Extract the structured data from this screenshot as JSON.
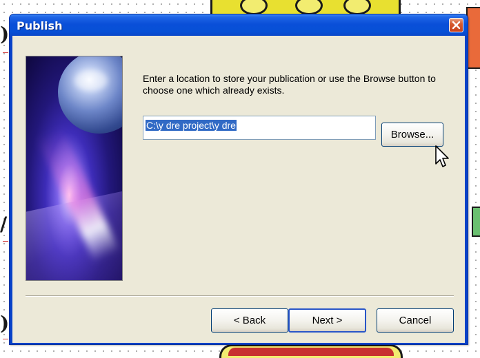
{
  "dialog": {
    "title": "Publish",
    "instructions": "Enter a location to store your publication or use the Browse button to choose one which already exists.",
    "path_value": "C:\\y dre project\\y dre",
    "browse_label": "Browse...",
    "back_label": "< Back",
    "next_label": "Next >",
    "cancel_label": "Cancel"
  },
  "icons": {
    "close": "close-icon",
    "cursor": "mouse-pointer-icon"
  },
  "colors": {
    "titlebar": "#0a4fd8",
    "client": "#ece9d8",
    "selection": "#316ac5",
    "close": "#d65a2f"
  }
}
